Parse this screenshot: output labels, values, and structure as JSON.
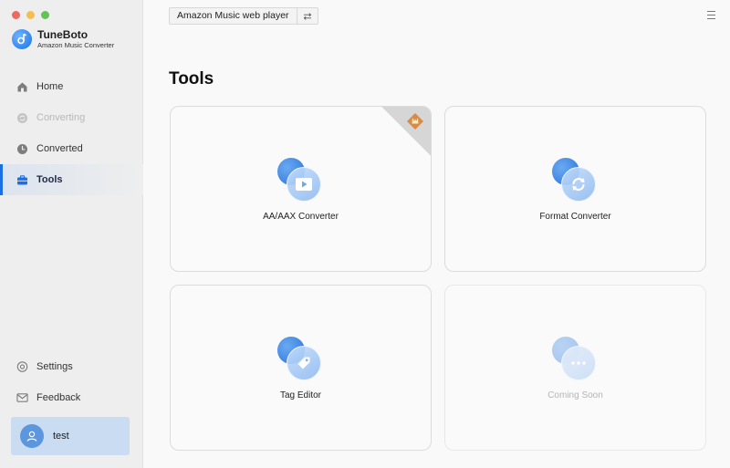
{
  "app": {
    "name": "TuneBoto",
    "subtitle": "Amazon Music Converter"
  },
  "sidebar": {
    "items": [
      {
        "label": "Home",
        "icon": "home-icon"
      },
      {
        "label": "Converting",
        "icon": "converting-icon",
        "disabled": true
      },
      {
        "label": "Converted",
        "icon": "clock-icon"
      },
      {
        "label": "Tools",
        "icon": "toolbox-icon",
        "active": true
      }
    ],
    "bottom_items": [
      {
        "label": "Settings",
        "icon": "gear-icon"
      },
      {
        "label": "Feedback",
        "icon": "mail-icon"
      }
    ],
    "user": {
      "name": "test"
    }
  },
  "header": {
    "source_label": "Amazon Music web player",
    "swap_icon": "swap-arrows-icon",
    "menu_icon": "hamburger-menu-icon"
  },
  "main": {
    "title": "Tools",
    "tools": [
      {
        "label": "AA/AAX Converter",
        "icon": "play-video-icon",
        "premium": true,
        "premium_badge_icon": "crown-badge-icon"
      },
      {
        "label": "Format Converter",
        "icon": "refresh-icon"
      },
      {
        "label": "Tag Editor",
        "icon": "tag-icon"
      },
      {
        "label": "Coming Soon",
        "icon": "ellipsis-icon",
        "disabled": true
      }
    ]
  },
  "colors": {
    "accent": "#1b6fe5",
    "active_bg": "#dce4ef",
    "user_bg": "#c9dcf2"
  }
}
